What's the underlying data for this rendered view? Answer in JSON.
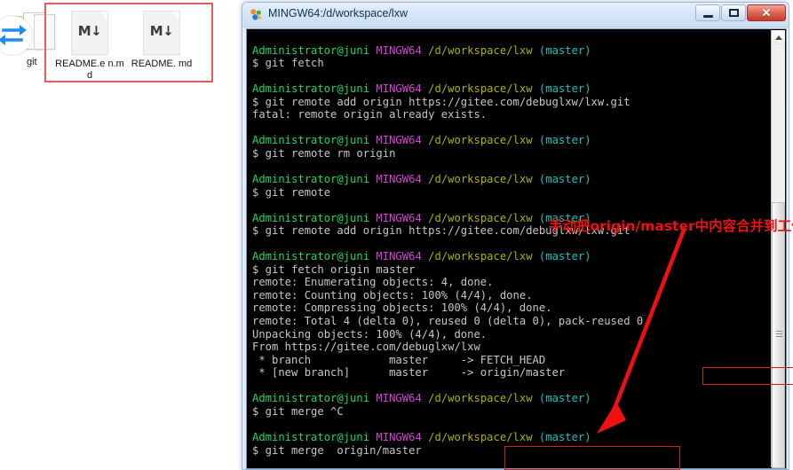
{
  "desktop": {
    "git_folder": {
      "label": "git",
      "icon": "folder-icon",
      "overlay_icon": "sync-icon"
    },
    "files": [
      {
        "name": "README.e\nn.md",
        "icon": "markdown-file-icon",
        "glyph": "M↓"
      },
      {
        "name": "README.\nmd",
        "icon": "markdown-file-icon",
        "glyph": "M↓"
      }
    ],
    "selection_color": "#f4545a"
  },
  "window": {
    "title": "MINGW64:/d/workspace/lxw",
    "icon": "git-bash-icon",
    "controls": {
      "minimize": "minimize-button",
      "maximize": "maximize-button",
      "close": "✕"
    }
  },
  "terminal": {
    "prompt": {
      "user": "Administrator@juni",
      "host": "MINGW64",
      "path": "/d/workspace/lxw",
      "branch": "(master)",
      "symbol": "$"
    },
    "colors": {
      "user": "#1ed760",
      "host": "#d741d7",
      "path": "#b0b000",
      "branch": "#18c0c0",
      "output": "#c6c6c6",
      "background": "#000000"
    },
    "blocks": [
      {
        "command": "git fetch",
        "output": []
      },
      {
        "command": "git remote add origin https://gitee.com/debuglxw/lxw.git",
        "output": [
          "fatal: remote origin already exists."
        ]
      },
      {
        "command": "git remote rm origin",
        "output": []
      },
      {
        "command": "git remote",
        "output": []
      },
      {
        "command": "git remote add origin https://gitee.com/debuglxw/lxw.git",
        "output": []
      },
      {
        "command": "git fetch origin master",
        "output": [
          "remote: Enumerating objects: 4, done.",
          "remote: Counting objects: 100% (4/4), done.",
          "remote: Compressing objects: 100% (4/4), done.",
          "remote: Total 4 (delta 0), reused 0 (delta 0), pack-reused 0",
          "Unpacking objects: 100% (4/4), done.",
          "From https://gitee.com/debuglxw/lxw",
          " * branch            master     -> FETCH_HEAD",
          " * [new branch]      master     -> origin/master"
        ]
      },
      {
        "command": "git merge ^C",
        "output": []
      },
      {
        "command": "git merge  origin/master",
        "output": []
      }
    ]
  },
  "annotations": {
    "note": "手动把origin/master中内容合并到工作区中",
    "note_color": "#ee1111",
    "arrow_color": "#f01010",
    "highlight_color": "#d0201e",
    "highlights": [
      "origin/master",
      "git merge  origin/master"
    ]
  },
  "scrollbar": {
    "position_pct": 68,
    "up_arrow": "scroll-up-arrow"
  }
}
